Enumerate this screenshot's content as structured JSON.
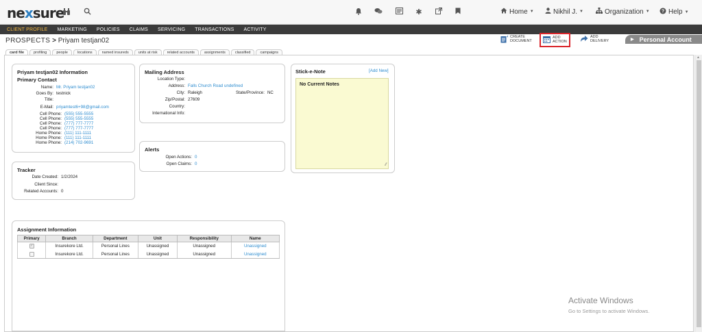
{
  "app": {
    "logo": "nexsure"
  },
  "topbar": {
    "home_label": "Home",
    "user_label": "Nikhil J.",
    "org_label": "Organization",
    "help_label": "Help"
  },
  "nav": {
    "items": [
      "CLIENT PROFILE",
      "MARKETING",
      "POLICIES",
      "CLAIMS",
      "SERVICING",
      "TRANSACTIONS",
      "ACTIVITY"
    ]
  },
  "title": {
    "crumb": "PROSPECTS",
    "separator": ">",
    "name": "Priyam testjan02"
  },
  "actions": {
    "create_document": [
      "CREATE",
      "DOCUMENT"
    ],
    "add_action": [
      "ADD",
      "ACTION"
    ],
    "add_delivery": [
      "ADD",
      "DELIVERY"
    ],
    "account_tab": "Personal Account"
  },
  "subtabs": [
    "card file",
    "profiling",
    "people",
    "locations",
    "named insureds",
    "units at risk",
    "related accounts",
    "assignments",
    "classified",
    "campaigns"
  ],
  "info": {
    "title": "Priyam testjan02 Information",
    "primary_contact": "Primary Contact",
    "name_label": "Name:",
    "name_value": "Mr. Priyam testjan02",
    "goesby_label": "Goes By:",
    "goesby_value": "testnick",
    "title_label": "Title:",
    "title_value": "",
    "email_label": "E-Mail:",
    "email_value": "priyamtest6+98@gmail.com",
    "phones": [
      {
        "label": "Cell Phone:",
        "value": "(555) 555-5555"
      },
      {
        "label": "Cell Phone:",
        "value": "(555) 555-5555"
      },
      {
        "label": "Cell Phone:",
        "value": "(777) 777-7777"
      },
      {
        "label": "Cell Phone:",
        "value": "(777) 777-7777"
      },
      {
        "label": "Home Phone:",
        "value": "(111) 111-1111"
      },
      {
        "label": "Home Phone:",
        "value": "(111) 111-1111"
      },
      {
        "label": "Home Phone:",
        "value": "(214) 702-9691"
      }
    ]
  },
  "tracker": {
    "title": "Tracker",
    "created_label": "Date Created:",
    "created_value": "1/2/2024",
    "since_label": "Client Since:",
    "since_value": "",
    "related_label": "Related Accounts:",
    "related_value": "0"
  },
  "mailing": {
    "title": "Mailing Address",
    "loctype_label": "Location Type:",
    "loctype_value": "",
    "address_label": "Address:",
    "address_value": "Falls Church Road undefined",
    "city_label": "City:",
    "city_value": "Raleigh",
    "state_label": "State/Province:",
    "state_value": "NC",
    "zip_label": "Zip/Postal:",
    "zip_value": "27609",
    "country_label": "Country:",
    "country_value": "",
    "intl_label": "International Info:",
    "intl_value": ""
  },
  "alerts": {
    "title": "Alerts",
    "actions_label": "Open Actions:",
    "actions_value": "0",
    "claims_label": "Open Claims:",
    "claims_value": "0"
  },
  "notes": {
    "title": "Stick-e-Note",
    "add_link": "[Add New]",
    "empty_text": "No Current Notes"
  },
  "assignment": {
    "title": "Assignment Information",
    "headers": [
      "Primary",
      "Branch",
      "Department",
      "Unit",
      "Responsibility",
      "Name"
    ],
    "rows": [
      {
        "branch": "Insurekore Ltd.",
        "department": "Personal Lines",
        "unit": "Unassigned",
        "responsibility": "Unassigned",
        "name": "Unassigned"
      },
      {
        "branch": "Insurekore Ltd.",
        "department": "Personal Lines",
        "unit": "Unassigned",
        "responsibility": "Unassigned",
        "name": "Unassigned"
      }
    ]
  },
  "watermark": {
    "line1": "Activate Windows",
    "line2": "Go to Settings to activate Windows."
  },
  "colors": {
    "nav_bg": "#3b3b3b",
    "nav_active": "#f4b942",
    "link": "#2d8ccf",
    "highlight": "#d9242a",
    "note_bg": "#fafad2"
  }
}
